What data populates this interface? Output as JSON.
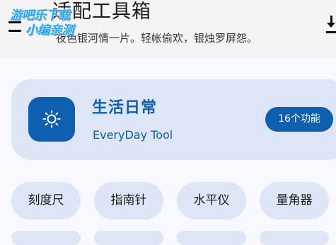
{
  "header": {
    "title": "适配工具箱",
    "subtitle": "夜色银河情一片。轻帐偷欢，银烛罗屏怨。",
    "watermark_line1": "游吧乐下载",
    "watermark_line2": "小编亲测"
  },
  "card": {
    "title": "生活日常",
    "subtitle": "EveryDay Tool",
    "badge": "16个功能",
    "icon": "sun-icon"
  },
  "tools": [
    {
      "label": "刻度尺"
    },
    {
      "label": "指南针"
    },
    {
      "label": "水平仪"
    },
    {
      "label": "量角器"
    }
  ],
  "icons": {
    "menu": "menu-icon",
    "download": "download-icon"
  },
  "colors": {
    "accent": "#0e5fb0",
    "card_bg": "#dde5f6",
    "page_bg": "#f8f9fe"
  }
}
